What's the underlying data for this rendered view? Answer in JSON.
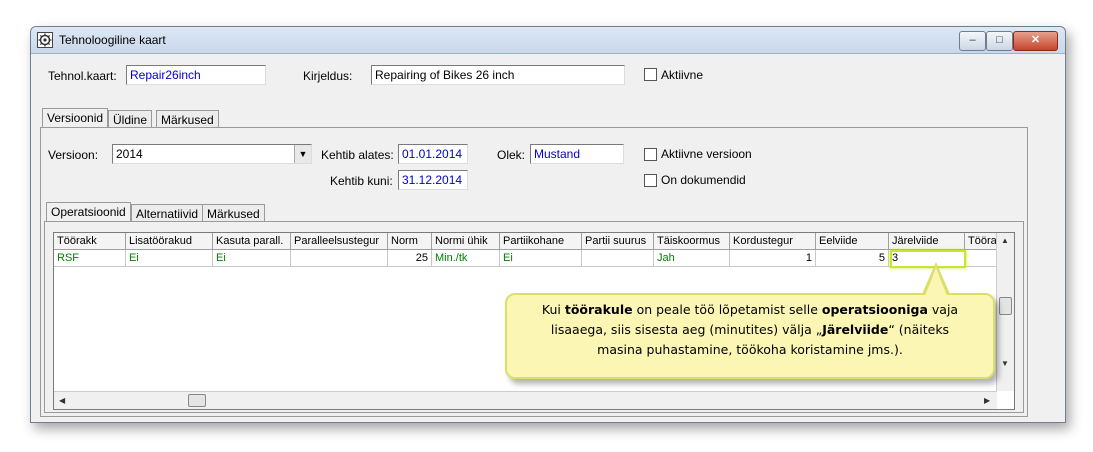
{
  "window": {
    "title": "Tehnoloogiline kaart",
    "buttons": {
      "minimize": "–",
      "maximize": "□",
      "close": "✕"
    }
  },
  "header": {
    "card_label": "Tehnol.kaart:",
    "card_value": "Repair26inch",
    "desc_label": "Kirjeldus:",
    "desc_value": "Repairing of Bikes 26 inch",
    "active_label": "Aktiivne",
    "active_checked": false
  },
  "top_tabs": [
    "Versioonid",
    "Üldine",
    "Märkused"
  ],
  "version": {
    "version_label": "Versioon:",
    "version_value": "2014",
    "valid_from_label": "Kehtib alates:",
    "valid_from_value": "01.01.2014",
    "valid_to_label": "Kehtib kuni:",
    "valid_to_value": "31.12.2014",
    "state_label": "Olek:",
    "state_value": "Mustand",
    "active_version_label": "Aktiivne versioon",
    "has_documents_label": "On dokumendid"
  },
  "sub_tabs": [
    "Operatsioonid",
    "Alternatiivid",
    "Märkused"
  ],
  "grid": {
    "columns": [
      "Töörakk",
      "Lisatöörakud",
      "Kasuta parall.",
      "Paralleelsustegur",
      "Norm",
      "Normi ühik",
      "Partiikohane",
      "Partii suurus",
      "Täiskoormus",
      "Kordustegur",
      "Eelviide",
      "Järelviide",
      "Tööraku l"
    ],
    "rows": [
      [
        "RSF",
        "Ei",
        "Ei",
        "",
        "25",
        "Min./tk",
        "Ei",
        "",
        "Jah",
        "1",
        "5",
        "3",
        ""
      ]
    ]
  },
  "callout": {
    "line1_a": "Kui ",
    "line1_b": "töörakule",
    "line1_c": " on peale töö lõpetamist selle ",
    "line1_d": "operatsiooniga",
    "line1_e": " vaja",
    "line2_a": "lisaaega, siis sisesta aeg (minutites) välja „",
    "line2_b": "Järelviide",
    "line2_c": "“ (näiteks",
    "line3": "masina puhastamine, töökoha koristamine jms.)."
  },
  "colors": {
    "value_text": "#0000cc",
    "row_text": "#008000",
    "callout_bg": "#fcf6b4",
    "highlight": "#c4e82a"
  }
}
